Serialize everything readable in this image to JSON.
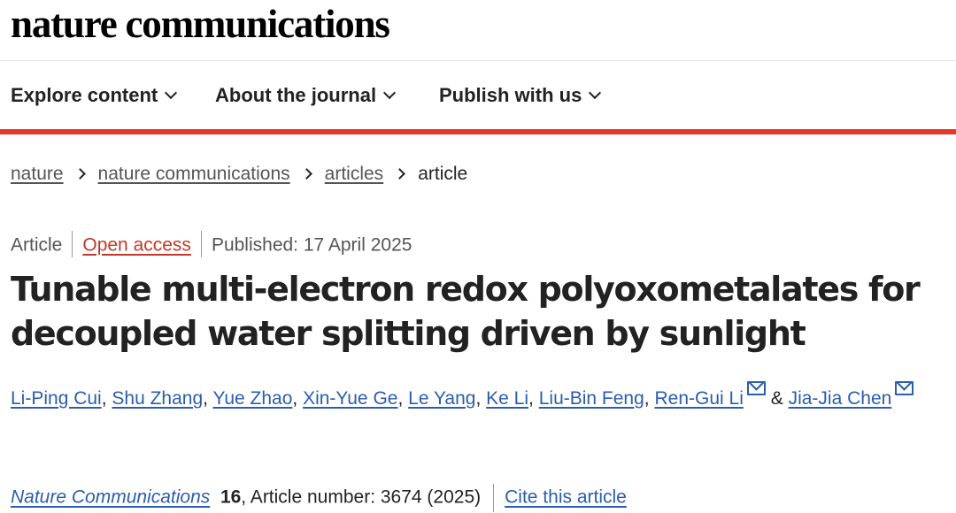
{
  "header": {
    "logo": "nature communications"
  },
  "nav": {
    "items": [
      {
        "label": "Explore content"
      },
      {
        "label": "About the journal"
      },
      {
        "label": "Publish with us"
      }
    ],
    "accent_color": "#e4392b"
  },
  "breadcrumb": {
    "items": [
      "nature",
      "nature communications",
      "articles"
    ],
    "current": "article"
  },
  "article": {
    "type": "Article",
    "access": "Open access",
    "published": "Published: 17 April 2025",
    "title": "Tunable multi-electron redox polyoxometalates for decoupled water splitting driven by sunlight",
    "authors": [
      "Li-Ping Cui",
      "Shu Zhang",
      "Yue Zhao",
      "Xin-Yue Ge",
      "Le Yang",
      "Ke Li",
      "Liu-Bin Feng",
      "Ren-Gui Li",
      "Jia-Jia Chen"
    ],
    "author_separator": ",",
    "author_ampersand": "&",
    "corresponding_icon": "envelope-icon",
    "citation": {
      "journal": "Nature Communications",
      "volume": "16",
      "details": ", Article number: 3674 (2025)",
      "cite_label": "Cite this article"
    }
  }
}
